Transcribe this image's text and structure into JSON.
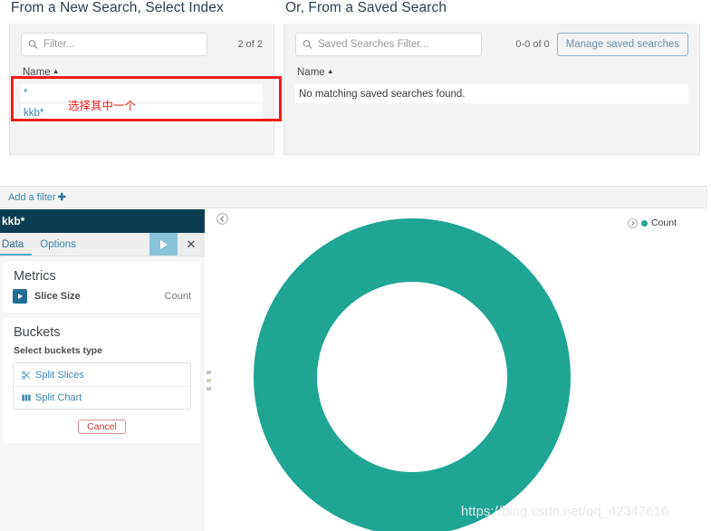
{
  "wizard": {
    "left": {
      "title": "From a New Search, Select Index",
      "search_placeholder": "Filter...",
      "search_value": "",
      "count": "2 of 2",
      "column_header": "Name",
      "sort_caret": "▲",
      "rows": [
        {
          "name": "*"
        },
        {
          "name": "kkb*"
        }
      ]
    },
    "right": {
      "title": "Or, From a Saved Search",
      "search_placeholder": "Saved Searches Filter...",
      "search_value": "",
      "count": "0-0 of 0",
      "manage_button": "Manage saved searches",
      "column_header": "Name",
      "sort_caret": "▲",
      "empty_message": "No matching saved searches found."
    }
  },
  "annotation": {
    "text": "选择其中一个",
    "color": "#f01c1c"
  },
  "filter_bar": {
    "add_filter_label": "Add a filter",
    "plus": "✚"
  },
  "vis_editor": {
    "index_title": "kkb*",
    "tabs": [
      {
        "label": "Data",
        "active": true
      },
      {
        "label": "Options",
        "active": false
      }
    ],
    "apply_icon": "play-icon",
    "close_icon": "close-icon",
    "metrics": {
      "title": "Metrics",
      "slice_label": "Slice Size",
      "slice_value": "Count"
    },
    "buckets": {
      "title": "Buckets",
      "subtitle": "Select buckets type",
      "options": [
        {
          "label": "Split Slices",
          "icon": "scissors-icon"
        },
        {
          "label": "Split Chart",
          "icon": "grid-icon"
        }
      ],
      "cancel_label": "Cancel"
    }
  },
  "chart_panel": {
    "collapse_left_icon": "chevron-left-circle-icon",
    "legend_toggle_icon": "chevron-right-circle-icon",
    "legend_label": "Count"
  },
  "watermark": "https://blog.csdn.net/qq_42347616",
  "colors": {
    "teal": "#1ea593",
    "dark_navy": "#0b3d52",
    "link_blue": "#3a87ad",
    "panel_bg": "#f4f4f4",
    "accent_apply": "#8ac2da"
  },
  "chart_data": {
    "type": "pie",
    "title": "",
    "donut": true,
    "labels": [
      "Count"
    ],
    "values": [
      100
    ],
    "slice_colors": [
      "#1ea593"
    ],
    "legend": [
      "Count"
    ],
    "legend_position": "top-right",
    "grid": false,
    "annotations": []
  }
}
